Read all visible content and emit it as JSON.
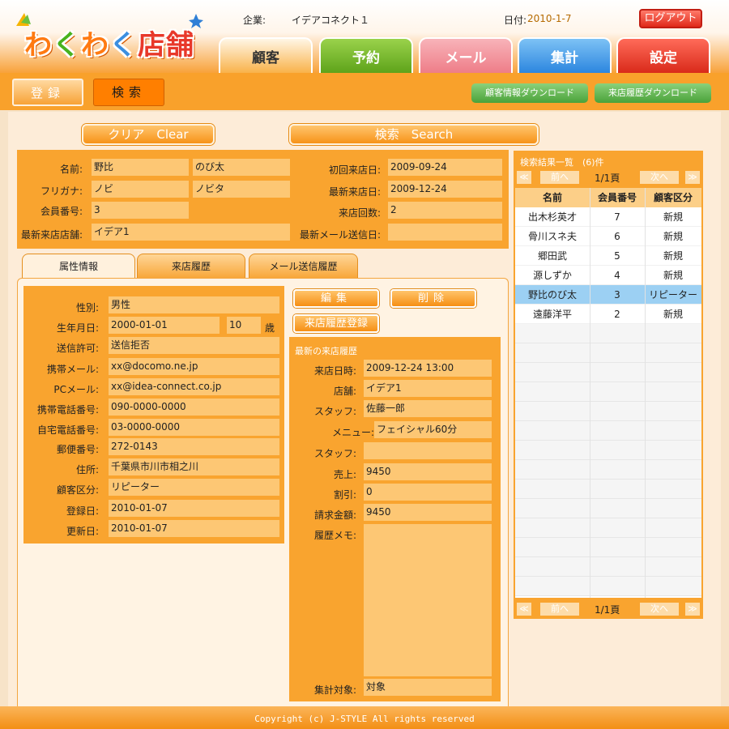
{
  "app": {
    "logo_parts": [
      "わ",
      "く",
      "わ",
      "く",
      "店",
      "舗"
    ],
    "company_label": "企業:",
    "company": "イデアコネクト１",
    "date_label": "日付:",
    "date": "2010-1-7",
    "logout": "ログアウト"
  },
  "tabs": [
    "顧客",
    "予約",
    "メール",
    "集計",
    "設定"
  ],
  "subnav": {
    "register": "登録",
    "search": "検索",
    "download_customers": "顧客情報ダウンロード",
    "download_visits": "来店履歴ダウンロード"
  },
  "search_bar": {
    "clear": "クリア　Clear",
    "search": "検索　Search"
  },
  "customer": {
    "name_label": "名前:",
    "last_name": "野比",
    "first_name": "のび太",
    "kana_label": "フリガナ:",
    "last_kana": "ノビ",
    "first_kana": "ノビタ",
    "member_no_label": "会員番号:",
    "member_no": "3",
    "latest_store_label": "最新来店店舗:",
    "latest_store": "イデア1",
    "first_visit_label": "初回来店日:",
    "first_visit": "2009-09-24",
    "latest_visit_label": "最新来店日:",
    "latest_visit": "2009-12-24",
    "visit_count_label": "来店回数:",
    "visit_count": "2",
    "latest_mail_label": "最新メール送信日:",
    "latest_mail": ""
  },
  "subtabs": [
    "属性情報",
    "来店履歴",
    "メール送信履歴"
  ],
  "attributes": {
    "gender_label": "性別:",
    "gender": "男性",
    "birth_label": "生年月日:",
    "birth": "2000-01-01",
    "age": "10",
    "age_unit": "歳",
    "send_label": "送信許可:",
    "send": "送信拒否",
    "mobile_mail_label": "携帯メール:",
    "mobile_mail": "xx@docomo.ne.jp",
    "pc_mail_label": "PCメール:",
    "pc_mail": "xx@idea-connect.co.jp",
    "mobile_tel_label": "携帯電話番号:",
    "mobile_tel": "090-0000-0000",
    "home_tel_label": "自宅電話番号:",
    "home_tel": "03-0000-0000",
    "zip_label": "郵便番号:",
    "zip": "272-0143",
    "address_label": "住所:",
    "address": "千葉県市川市相之川",
    "category_label": "顧客区分:",
    "category": "リピーター",
    "registered_label": "登録日:",
    "registered": "2010-01-07",
    "updated_label": "更新日:",
    "updated": "2010-01-07"
  },
  "actions": {
    "edit": "編集",
    "delete": "削除",
    "add_visit": "来店履歴登録"
  },
  "latest_visit": {
    "title": "最新の来店履歴",
    "datetime_label": "来店日時:",
    "datetime": "2009-12-24 13:00",
    "store_label": "店舗:",
    "store": "イデア1",
    "staff_label": "スタッフ:",
    "staff": "佐藤一郎",
    "menu_label": "メニュー:",
    "menu": "フェイシャル60分",
    "staff2_label": "スタッフ:",
    "staff2": "",
    "sales_label": "売上:",
    "sales": "9450",
    "discount_label": "割引:",
    "discount": "0",
    "billed_label": "請求金額:",
    "billed": "9450",
    "memo_label": "履歴メモ:",
    "memo": "",
    "aggregate_label": "集計対象:",
    "aggregate": "対象"
  },
  "results": {
    "title": "検索結果一覧　(6)件",
    "first": "≪",
    "prev": "前へ",
    "page": "1/1頁",
    "next": "次へ",
    "last": "≫",
    "headers": [
      "名前",
      "会員番号",
      "顧客区分"
    ],
    "rows": [
      {
        "name": "出木杉英才",
        "no": "7",
        "type": "新規"
      },
      {
        "name": "骨川スネ夫",
        "no": "6",
        "type": "新規"
      },
      {
        "name": "郷田武",
        "no": "5",
        "type": "新規"
      },
      {
        "name": "源しずか",
        "no": "4",
        "type": "新規"
      },
      {
        "name": "野比のび太",
        "no": "3",
        "type": "リピーター"
      },
      {
        "name": "遠藤洋平",
        "no": "2",
        "type": "新規"
      }
    ]
  },
  "footer": "Copyright (c) J-STYLE All rights reserved",
  "colors": {
    "accent": "#f9a42f",
    "selected_row": "#9cd0f3",
    "logout": "#e02a1a"
  }
}
